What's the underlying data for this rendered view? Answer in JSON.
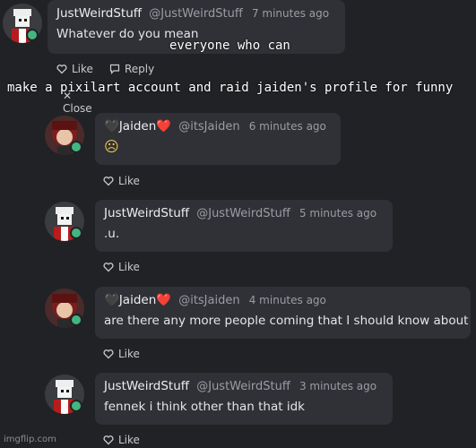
{
  "comments": [
    {
      "name": "JustWeirdStuff",
      "handle": "@JustWeirdStuff",
      "time": "7 minutes ago",
      "text": "Whatever do you mean",
      "like_label": "Like",
      "reply_label": "Reply",
      "close_label": "Close"
    },
    {
      "name": "Jaiden",
      "name_prefix": "🖤",
      "name_suffix": "❤️",
      "handle": "@itsJaiden",
      "time": "6 minutes ago",
      "text": "☹",
      "like_label": "Like"
    },
    {
      "name": "JustWeirdStuff",
      "handle": "@JustWeirdStuff",
      "time": "5 minutes ago",
      "text": ".u.",
      "like_label": "Like"
    },
    {
      "name": "Jaiden",
      "name_prefix": "🖤",
      "name_suffix": "❤️",
      "handle": "@itsJaiden",
      "time": "4 minutes ago",
      "text": "are there any more people coming that I should know about",
      "like_label": "Like"
    },
    {
      "name": "JustWeirdStuff",
      "handle": "@JustWeirdStuff",
      "time": "3 minutes ago",
      "text": "fennek i think other than that idk",
      "like_label": "Like"
    }
  ],
  "overlay": {
    "line1": "everyone who can",
    "line2": "make a pixilart account and raid jaiden's profile for funny"
  },
  "watermark": "imgflip.com",
  "colors": {
    "background": "#202225",
    "bubble": "#2f3136",
    "online": "#43b581"
  }
}
